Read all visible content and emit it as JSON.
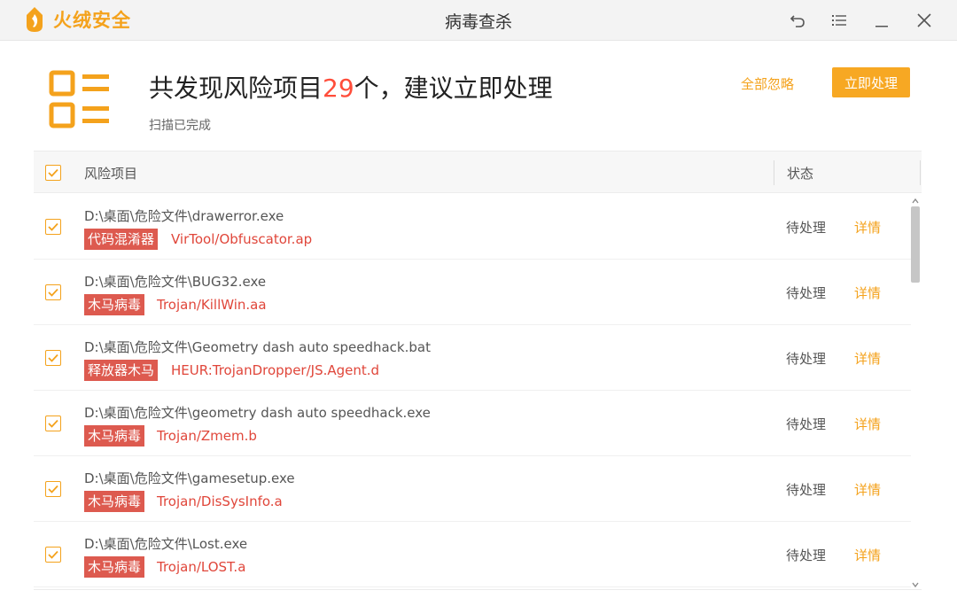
{
  "app": {
    "brand_name": "火绒安全",
    "window_title": "病毒查杀"
  },
  "summary": {
    "title_prefix": "共发现风险项目",
    "count": "29",
    "title_suffix": "个，建议立即处理",
    "subtitle": "扫描已完成",
    "ignore_all_label": "全部忽略",
    "process_now_label": "立即处理"
  },
  "table": {
    "col_risk": "风险项目",
    "col_status": "状态",
    "rows": [
      {
        "path": "D:\\桌面\\危险文件\\drawerror.exe",
        "tag": "代码混淆器",
        "virus": "VirTool/Obfuscator.ap",
        "status": "待处理",
        "detail": "详情"
      },
      {
        "path": "D:\\桌面\\危险文件\\BUG32.exe",
        "tag": "木马病毒",
        "virus": "Trojan/KillWin.aa",
        "status": "待处理",
        "detail": "详情"
      },
      {
        "path": "D:\\桌面\\危险文件\\Geometry dash auto speedhack.bat",
        "tag": "释放器木马",
        "virus": "HEUR:TrojanDropper/JS.Agent.d",
        "status": "待处理",
        "detail": "详情"
      },
      {
        "path": "D:\\桌面\\危险文件\\geometry dash auto speedhack.exe",
        "tag": "木马病毒",
        "virus": "Trojan/Zmem.b",
        "status": "待处理",
        "detail": "详情"
      },
      {
        "path": "D:\\桌面\\危险文件\\gamesetup.exe",
        "tag": "木马病毒",
        "virus": "Trojan/DisSysInfo.a",
        "status": "待处理",
        "detail": "详情"
      },
      {
        "path": "D:\\桌面\\危险文件\\Lost.exe",
        "tag": "木马病毒",
        "virus": "Trojan/LOST.a",
        "status": "待处理",
        "detail": "详情"
      }
    ]
  },
  "colors": {
    "accent": "#f4a21c",
    "danger_tag": "#dd5a4f",
    "danger_text": "#e0463a",
    "count": "#ff4d3a"
  },
  "icons": {
    "brand": "flame-logo-icon",
    "back": "undo-icon",
    "menu": "list-menu-icon",
    "minimize": "minimize-icon",
    "close": "close-icon",
    "summary": "risk-list-icon",
    "check": "checkbox-checked-icon"
  }
}
